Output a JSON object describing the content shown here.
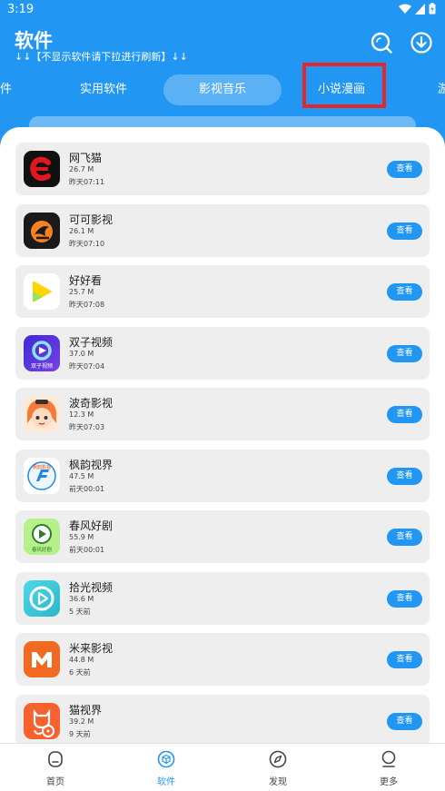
{
  "status_bar": {
    "time": "3:19"
  },
  "header": {
    "title": "软件",
    "subtitle": "↓↓【不显示软件请下拉进行刷新】↓↓",
    "icons": [
      "search-icon",
      "download-icon"
    ]
  },
  "tabs": [
    {
      "label": "件"
    },
    {
      "label": "实用软件"
    },
    {
      "label": "影视音乐",
      "selected": true
    },
    {
      "label": "小说漫画"
    },
    {
      "label": "游"
    }
  ],
  "colors": {
    "primary": "#2196F3",
    "highlight": "#e5262b",
    "card_bg": "#eeeeee"
  },
  "apps": [
    {
      "name": "网飞猫",
      "size": "26.7 M",
      "time": "昨天07:11",
      "button": "查看",
      "icon": "netflix-cat-icon"
    },
    {
      "name": "可可影视",
      "size": "26.1 M",
      "time": "昨天07:10",
      "button": "查看",
      "icon": "keke-icon"
    },
    {
      "name": "好好看",
      "size": "25.7 M",
      "time": "昨天07:08",
      "button": "查看",
      "icon": "play-triangle-icon"
    },
    {
      "name": "双子视频",
      "size": "37.0 M",
      "time": "昨天07:04",
      "button": "查看",
      "icon": "gemini-video-icon",
      "icon_text": "双子视频"
    },
    {
      "name": "波奇影视",
      "size": "12.3 M",
      "time": "昨天07:03",
      "button": "查看",
      "icon": "anime-girl-icon"
    },
    {
      "name": "枫韵视界",
      "size": "47.5 M",
      "time": "前天00:01",
      "button": "查看",
      "icon": "fengyun-icon",
      "icon_text": "枫韵影视"
    },
    {
      "name": "春风好剧",
      "size": "55.9 M",
      "time": "前天00:01",
      "button": "查看",
      "icon": "chunfeng-play-icon",
      "icon_text": "春风好剧"
    },
    {
      "name": "拾光视频",
      "size": "36.6 M",
      "time": "5 天前",
      "button": "查看",
      "icon": "play-circle-icon"
    },
    {
      "name": "米来影视",
      "size": "44.8 M",
      "time": "6 天前",
      "button": "查看",
      "icon": "letter-m-icon"
    },
    {
      "name": "猫视界",
      "size": "39.2 M",
      "time": "9 天前",
      "button": "查看",
      "icon": "cat-film-icon"
    }
  ],
  "bottom_nav": [
    {
      "label": "首页",
      "icon": "home-icon"
    },
    {
      "label": "软件",
      "icon": "software-cube-icon",
      "selected": true
    },
    {
      "label": "发现",
      "icon": "compass-icon"
    },
    {
      "label": "更多",
      "icon": "more-person-icon"
    }
  ]
}
